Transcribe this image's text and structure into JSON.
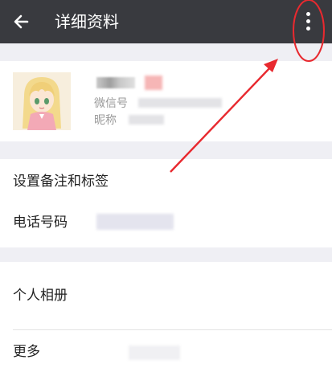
{
  "topbar": {
    "back_icon": "arrow-left-icon",
    "title": "详细资料",
    "more_icon": "more-vertical-icon"
  },
  "profile": {
    "avatar": "anime-girl-avatar",
    "wechat_prefix": "微信号",
    "nickname_prefix": "昵称"
  },
  "rows": {
    "remark_tags": "设置备注和标签",
    "phone": "电话号码",
    "album": "个人相册",
    "more": "更多"
  },
  "colors": {
    "topbar": "#393a3f",
    "background": "#efeff4",
    "annotation": "#e8292f"
  }
}
